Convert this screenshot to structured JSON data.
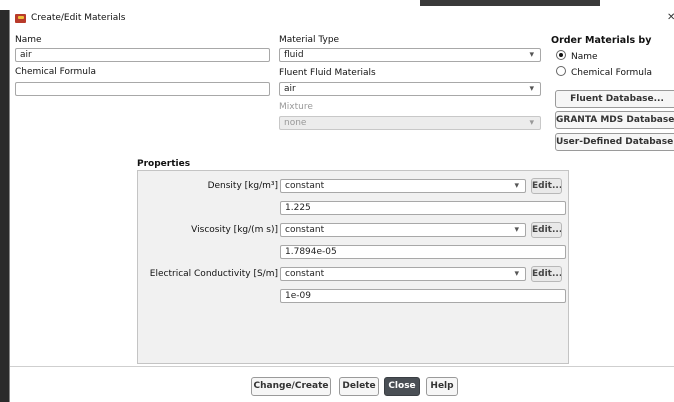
{
  "window": {
    "title": "Create/Edit Materials"
  },
  "name": {
    "label": "Name",
    "value": "air"
  },
  "chemical_formula": {
    "label": "Chemical Formula",
    "value": ""
  },
  "material_type": {
    "label": "Material Type",
    "value": "fluid"
  },
  "fluent_materials": {
    "label": "Fluent Fluid Materials",
    "value": "air"
  },
  "mixture": {
    "label": "Mixture",
    "value": "none"
  },
  "order_by": {
    "label": "Order Materials by",
    "options": [
      {
        "label": "Name",
        "selected": true
      },
      {
        "label": "Chemical Formula",
        "selected": false
      }
    ]
  },
  "database_buttons": {
    "fluent": "Fluent Database...",
    "granta": "GRANTA MDS Database...",
    "user": "User-Defined Database..."
  },
  "properties": {
    "heading": "Properties",
    "edit_label": "Edit...",
    "rows": [
      {
        "label": "Density [kg/m³]",
        "method": "constant",
        "value": "1.225"
      },
      {
        "label": "Viscosity [kg/(m s)]",
        "method": "constant",
        "value": "1.7894e-05"
      },
      {
        "label": "Electrical Conductivity [S/m]",
        "method": "constant",
        "value": "1e-09"
      }
    ]
  },
  "footer": {
    "change_create": "Change/Create",
    "delete": "Delete",
    "close": "Close",
    "help": "Help"
  },
  "colors": {
    "primary_button": "#4a4f55",
    "title_icon": "#b83a2a"
  }
}
